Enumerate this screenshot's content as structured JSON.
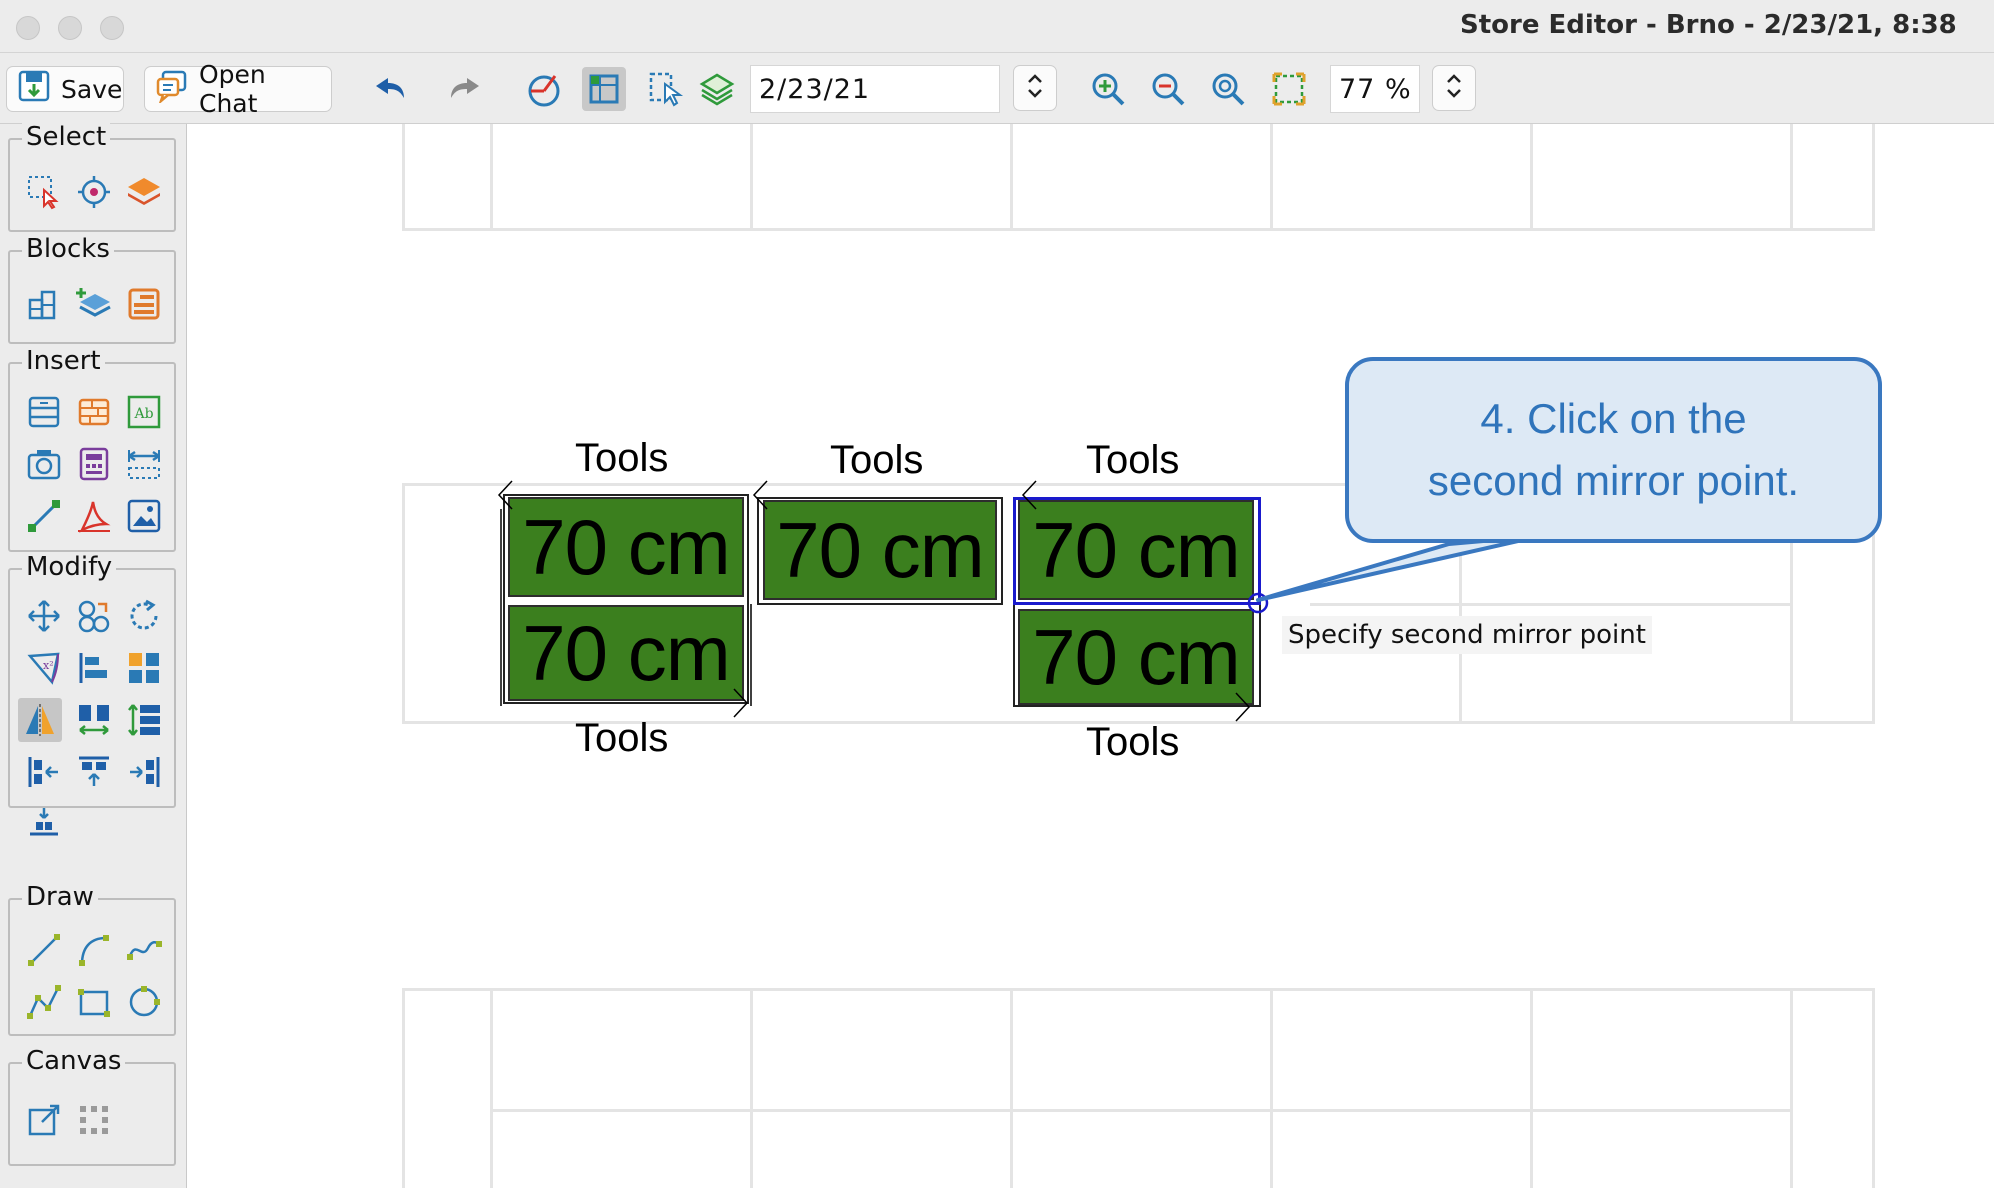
{
  "window": {
    "title": "Store Editor - Brno - 2/23/21, 8:38"
  },
  "toolbar": {
    "save_label": "Save",
    "open_chat_label": "Open Chat",
    "date_value": "2/23/21",
    "zoom_value": "77 %"
  },
  "palette": {
    "groups": [
      {
        "label": "Select",
        "icons": [
          "rectangle-select-icon",
          "point-select-icon",
          "layer-select-icon"
        ]
      },
      {
        "label": "Blocks",
        "icons": [
          "block-library-icon",
          "add-block-icon",
          "block-properties-icon"
        ]
      },
      {
        "label": "Insert",
        "icons": [
          "shelf-icon",
          "brick-wall-icon",
          "text-box-icon",
          "camera-icon",
          "calculator-icon",
          "dimension-icon",
          "line-tool-icon",
          "pdf-icon",
          "image-icon"
        ]
      },
      {
        "label": "Modify",
        "icons": [
          "move-icon",
          "copy-icon",
          "rotate-icon",
          "scale-icon",
          "align-left-icon",
          "grid-icon",
          "mirror-icon",
          "distribute-horizontal-icon",
          "distribute-vertical-icon",
          "align-start-icon",
          "align-top-icon",
          "align-end-icon",
          "stack-icon"
        ]
      },
      {
        "label": "Draw",
        "icons": [
          "draw-line-icon",
          "draw-arc-icon",
          "draw-curve-icon",
          "draw-polyline-icon",
          "draw-rectangle-icon",
          "draw-circle-icon"
        ]
      },
      {
        "label": "Canvas",
        "icons": [
          "canvas-resize-icon",
          "canvas-grid-icon"
        ]
      }
    ],
    "active_tool": "mirror-icon"
  },
  "canvas": {
    "fixtures": [
      {
        "top_label": "Tools",
        "bottom_label": "Tools",
        "panels": [
          "70 cm",
          "70 cm"
        ],
        "selected": false
      },
      {
        "top_label": "Tools",
        "panels": [
          "70 cm"
        ],
        "selected": false
      },
      {
        "top_label": "Tools",
        "bottom_label": "Tools",
        "panels": [
          "70 cm",
          "70 cm"
        ],
        "selected": true
      }
    ],
    "panel_color": "#3b7f1e",
    "selection_color": "#1a1acc",
    "prompt_hint": "Specify second mirror point"
  },
  "callout": {
    "text_line1": "4. Click on the",
    "text_line2": "second mirror point.",
    "border_color": "#3a78c0",
    "fill_color": "#dde9f5"
  }
}
